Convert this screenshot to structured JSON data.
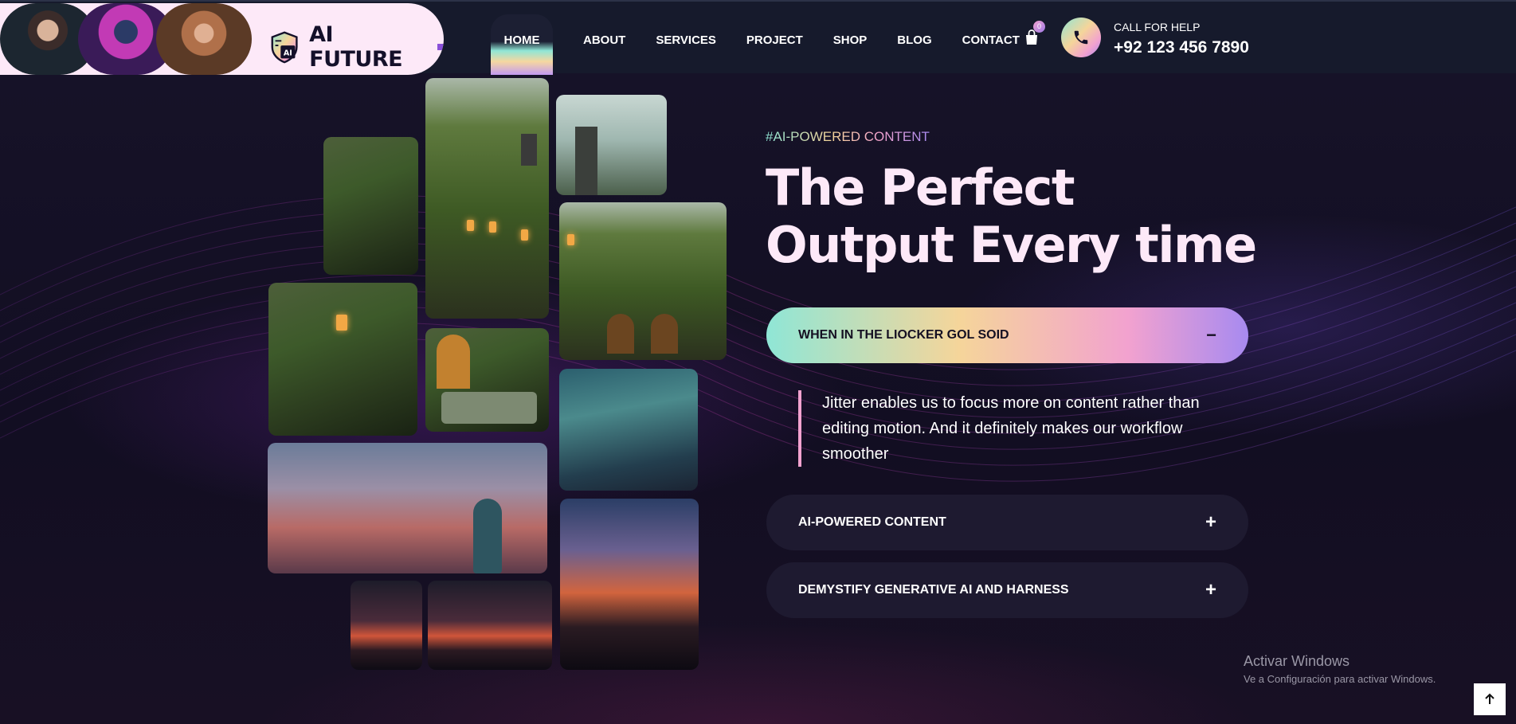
{
  "header": {
    "brand_name": "AI FUTURE",
    "brand_badge": "AI",
    "nav": [
      {
        "label": "HOME",
        "active": true
      },
      {
        "label": "ABOUT"
      },
      {
        "label": "SERVICES"
      },
      {
        "label": "PROJECT"
      },
      {
        "label": "SHOP"
      },
      {
        "label": "BLOG"
      },
      {
        "label": "CONTACT"
      }
    ],
    "cart_count": "0",
    "call_label": "CALL FOR HELP",
    "call_number": "+92 123 456 7890"
  },
  "hero": {
    "tag": "#AI-POWERED CONTENT",
    "title_line1": "The Perfect",
    "title_line2": "Output Every time"
  },
  "accordion": [
    {
      "title": "WHEN IN THE LIOCKER GOL SOID",
      "open": true,
      "sign": "−",
      "body": "Jitter enables us to focus more on content rather than editing motion. And it definitely makes our workflow smoother"
    },
    {
      "title": "AI-POWERED CONTENT",
      "open": false,
      "sign": "+"
    },
    {
      "title": "DEMYSTIFY GENERATIVE AI AND HARNESS",
      "open": false,
      "sign": "+"
    }
  ],
  "windows_notice": {
    "title": "Activar Windows",
    "subtitle": "Ve a Configuración para activar Windows."
  },
  "icons": {
    "cart": "shopping-bag-icon",
    "phone": "phone-icon",
    "scroll_top": "arrow-up-icon"
  },
  "colors": {
    "accent_gradient": [
      "#8fe6d6",
      "#f5d59a",
      "#f2a2cf",
      "#a78af0"
    ],
    "background": "#140f24",
    "header_bg": "#161a2c",
    "title": "#fde9f8"
  }
}
